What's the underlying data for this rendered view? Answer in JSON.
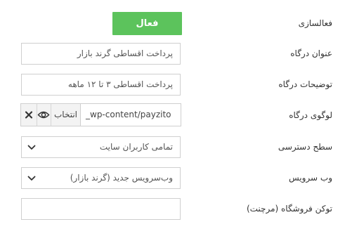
{
  "form": {
    "activation": {
      "label": "فعالسازی",
      "button": "فعال"
    },
    "gateway_title": {
      "label": "عنوان درگاه",
      "value": "پرداخت اقساطی گرند بازار"
    },
    "gateway_description": {
      "label": "توضیحات درگاه",
      "value": "پرداخت اقساطی ۳ تا ۱۲ ماهه"
    },
    "gateway_logo": {
      "label": "لوگوی درگاه",
      "value": "_wp-content/payzito",
      "choose_button": "انتخاب"
    },
    "access_level": {
      "label": "سطح دسترسی",
      "selected": "تمامی کاربران سایت"
    },
    "web_service": {
      "label": "وب سرویس",
      "selected": "وب‌سرویس جدید (گرند بازار)"
    },
    "merchant_token": {
      "label": "توکن فروشگاه (مرچنت)",
      "value": ""
    }
  },
  "colors": {
    "accent": "#5cc35c",
    "border": "#cfcfcf",
    "text": "#333333"
  },
  "icons": {
    "remove": "close-icon",
    "view": "eye-icon",
    "dropdown": "chevron-down-icon"
  }
}
